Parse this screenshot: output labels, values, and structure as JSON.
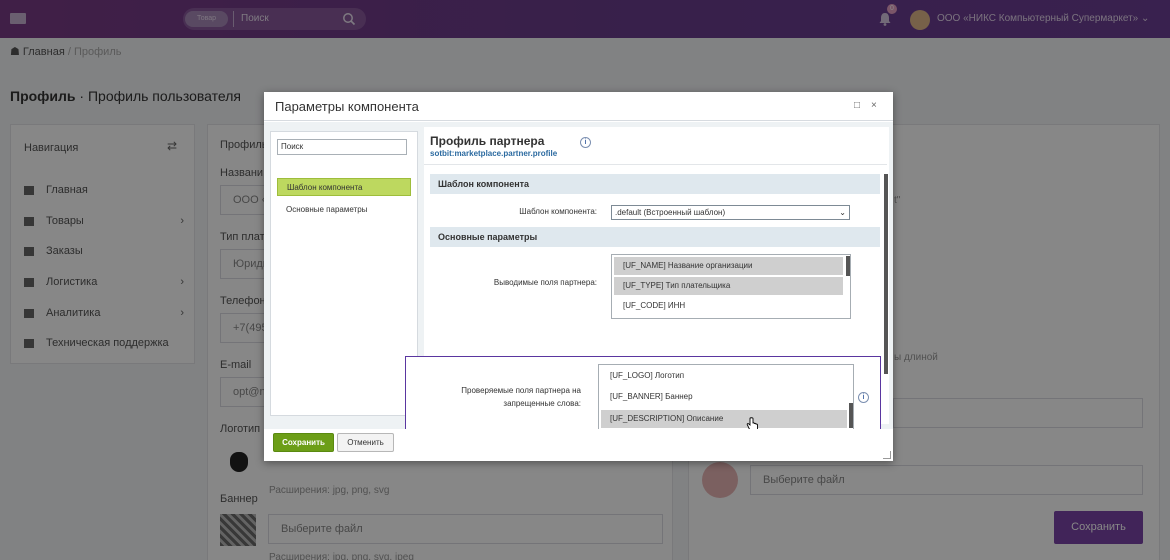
{
  "topbar": {
    "search_pill": "Товар",
    "search_text": "Поиск",
    "notifications_count": "0",
    "user_name": "ООО «НИКС Компьютерный Супермаркет» ⌄"
  },
  "breadcrumb": {
    "home": "Главная",
    "sep": "/",
    "current": "Профиль"
  },
  "page": {
    "title_bold": "Профиль",
    "title_rest": " · Профиль пользователя"
  },
  "nav": {
    "heading": "Навигация",
    "toggle": "⇄",
    "items": [
      {
        "label": "Главная",
        "chevron": ""
      },
      {
        "label": "Товары",
        "chevron": "›"
      },
      {
        "label": "Заказы",
        "chevron": ""
      },
      {
        "label": "Логистика",
        "chevron": "›"
      },
      {
        "label": "Аналитика",
        "chevron": "›"
      },
      {
        "label": "Техническая поддержка",
        "chevron": ""
      }
    ]
  },
  "background_form": {
    "profile": "Профиль",
    "name_label": "Названи",
    "name_value": "ООО «Н",
    "type_label": "Тип плате",
    "type_value": "Юриди",
    "phone_label": "Телефон",
    "phone_value": "+7(495)",
    "email_label": "E-mail",
    "email_value": "opt@ni",
    "logo_label": "Логотип",
    "logo_ext": "Расширения: jpg, png, svg",
    "banner_label": "Баннер",
    "choose_file": "Выберите файл",
    "banner_ext": "Расширения: jpg, png, svg, jpeg",
    "right_tail": "t\"",
    "right_hint": "ы длиной",
    "right_choose_file": "Выберите файл",
    "save": "Сохранить"
  },
  "dialog": {
    "title": "Параметры компонента",
    "maximize": "□",
    "close": "×",
    "search_placeholder": "Поиск",
    "sidebar_items": [
      "Шаблон компонента",
      "Основные параметры"
    ],
    "component_title": "Профиль партнера",
    "component_code": "sotbit:marketplace.partner.profile",
    "info": "i",
    "section_template": "Шаблон компонента",
    "template_label": "Шаблон компонента:",
    "template_value": ".default (Встроенный шаблон)",
    "section_main": "Основные параметры",
    "output_fields_label": "Выводимые поля партнера:",
    "output_fields": [
      {
        "label": "[UF_NAME] Название организации",
        "selected": true
      },
      {
        "label": "[UF_TYPE] Тип плательщика",
        "selected": true
      },
      {
        "label": "[UF_CODE] ИНН",
        "selected": false
      }
    ],
    "checked_fields_label_1": "Проверяемые поля партнера на",
    "checked_fields_label_2": "запрещенные слова:",
    "checked_fields": [
      {
        "label": "[UF_LOGO] Логотип",
        "selected": false
      },
      {
        "label": "[UF_BANNER] Баннер",
        "selected": false
      },
      {
        "label": "[UF_DESCRIPTION] Описание",
        "selected": true
      }
    ],
    "save_label": "Сохранить",
    "cancel_label": "Отменить"
  }
}
